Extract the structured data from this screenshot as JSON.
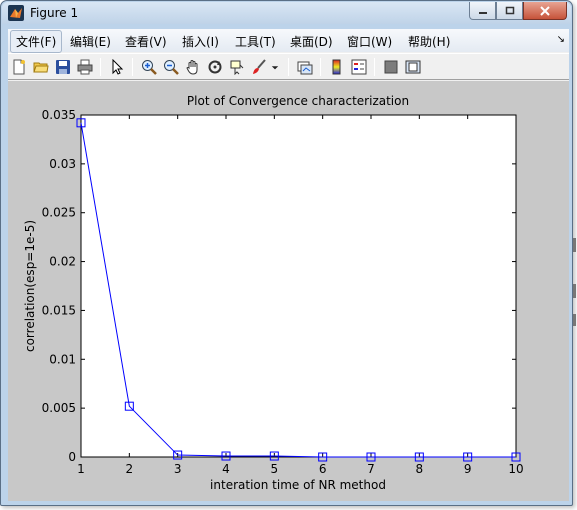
{
  "window": {
    "title": "Figure 1"
  },
  "menu": [
    "文件(F)",
    "编辑(E)",
    "查看(V)",
    "插入(I)",
    "工具(T)",
    "桌面(D)",
    "窗口(W)",
    "帮助(H)"
  ],
  "toolbar_icons": [
    "new-figure-icon",
    "open-file-icon",
    "save-icon",
    "print-icon",
    "edit-plot-arrow-icon",
    "zoom-in-icon",
    "zoom-out-icon",
    "pan-hand-icon",
    "rotate-3d-icon",
    "data-cursor-icon",
    "brush-icon",
    "brush-dropdown-icon",
    "link-plot-icon",
    "colorbar-icon",
    "legend-icon",
    "hide-plot-tools-icon",
    "show-plot-tools-icon"
  ],
  "colors": {
    "line": "#0000ff",
    "axes_bg": "#ffffff",
    "figure_bg": "#c8c8c8"
  },
  "chart_data": {
    "type": "line",
    "title": "Plot of Convergence characterization",
    "xlabel": "interation time of NR method",
    "ylabel": "correlation(esp=1e-5)",
    "x": [
      1,
      2,
      3,
      4,
      5,
      6,
      7,
      8,
      9,
      10
    ],
    "series": [
      {
        "values": [
          0.0342,
          0.0052,
          0.0002,
          0.0001,
          0.0001,
          0,
          0,
          0,
          0,
          0
        ],
        "marker": "square"
      }
    ],
    "xlim": [
      1,
      10
    ],
    "ylim": [
      0,
      0.035
    ],
    "xticks": [
      "1",
      "2",
      "3",
      "4",
      "5",
      "6",
      "7",
      "8",
      "9",
      "10"
    ],
    "yticks": [
      "0",
      "0.005",
      "0.01",
      "0.015",
      "0.02",
      "0.025",
      "0.03",
      "0.035"
    ],
    "grid": false
  }
}
